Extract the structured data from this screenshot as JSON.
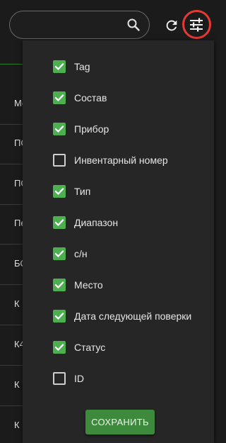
{
  "search": {
    "value": "",
    "placeholder": ""
  },
  "table_rows": [
    "Ме",
    "ПО",
    "ПО",
    "Пе",
    "БС",
    "К",
    "К4",
    "К",
    "К"
  ],
  "columns": [
    {
      "label": "Tag",
      "checked": true
    },
    {
      "label": "Состав",
      "checked": true
    },
    {
      "label": "Прибор",
      "checked": true
    },
    {
      "label": "Инвентарный номер",
      "checked": false
    },
    {
      "label": "Тип",
      "checked": true
    },
    {
      "label": "Диапазон",
      "checked": true
    },
    {
      "label": "с/н",
      "checked": true
    },
    {
      "label": "Место",
      "checked": true
    },
    {
      "label": "Дата следующей поверки",
      "checked": true
    },
    {
      "label": "Статус",
      "checked": true
    },
    {
      "label": "ID",
      "checked": false
    }
  ],
  "save_label": "СОХРАНИТЬ",
  "colors": {
    "accent": "#4caf50",
    "button": "#3d8a3d",
    "highlight": "#e53935",
    "background": "#1b1b1b",
    "panel": "#262626"
  },
  "icons": {
    "search": "search-icon",
    "refresh": "refresh-icon",
    "filter": "tune-icon"
  }
}
